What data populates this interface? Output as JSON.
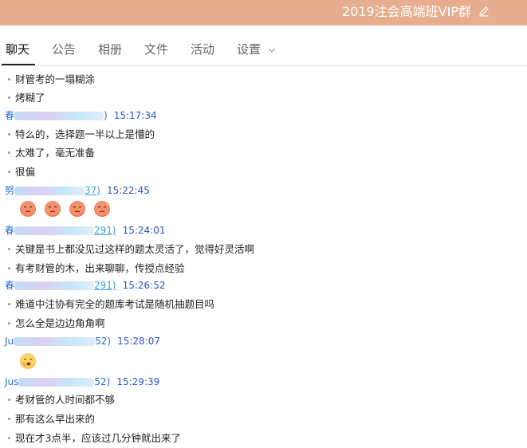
{
  "window": {
    "title": "2019注会高端班VIP群",
    "edit_icon": "pencil-icon",
    "colors": {
      "titlebar": "#e6ad8e"
    }
  },
  "tabs": [
    {
      "label": "聊天",
      "active": true
    },
    {
      "label": "公告",
      "active": false
    },
    {
      "label": "相册",
      "active": false
    },
    {
      "label": "文件",
      "active": false
    },
    {
      "label": "活动",
      "active": false
    },
    {
      "label": "设置",
      "active": false,
      "has_dropdown": true
    }
  ],
  "chat": {
    "messages_top": [
      {
        "text": "财管考的一塌糊涂"
      },
      {
        "text": "烤糊了"
      }
    ],
    "groups": [
      {
        "sender_prefix": "春",
        "sender_suffix": ")",
        "time": "15:17:34",
        "messages": [
          {
            "text": "特么的，选择题一半以上是懵的"
          },
          {
            "text": "太难了，毫无准备"
          },
          {
            "text": "很偏"
          }
        ]
      },
      {
        "sender_prefix": "努",
        "sender_suffix": "37)",
        "time": "15:22:45",
        "emoji": [
          "flushed-face-icon",
          "flushed-face-icon",
          "flushed-face-icon",
          "flushed-face-icon"
        ]
      },
      {
        "sender_prefix": "春",
        "sender_suffix": "291)",
        "time": "15:24:01",
        "messages": [
          {
            "text": "关键是书上都没见过这样的题太灵活了，觉得好灵活啊"
          },
          {
            "text": "有考财管的木，出来聊聊，传授点经验"
          }
        ]
      },
      {
        "sender_prefix": "春",
        "sender_suffix": "291)",
        "time": "15:26:52",
        "messages": [
          {
            "text": "难道中注协有完全的题库考试是随机抽题目吗"
          },
          {
            "text": "怎么全是边边角角啊"
          }
        ]
      },
      {
        "sender_prefix": "Ju",
        "sender_suffix": "52)",
        "time": "15:28:07",
        "emoji": [
          "yawning-face-icon"
        ]
      },
      {
        "sender_prefix": "Jus",
        "sender_suffix": "52)",
        "time": "15:29:39",
        "messages": [
          {
            "text": "考财管的人时间都不够"
          },
          {
            "text": "那有这么早出来的"
          },
          {
            "text": "现在才3点半，应该过几分钟就出来了"
          }
        ]
      }
    ]
  }
}
